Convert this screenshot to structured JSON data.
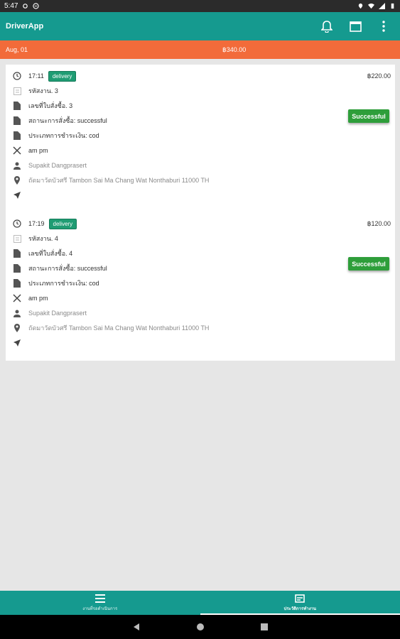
{
  "status_bar": {
    "time": "5:47"
  },
  "app": {
    "title": "DriverApp"
  },
  "summary": {
    "date": "Aug, 01",
    "total": "฿340.00"
  },
  "orders": [
    {
      "time": "17:11",
      "type_badge": "delivery",
      "price": "฿220.00",
      "status_button": "Successful",
      "employee": "รหัสงาน. 3",
      "order_no": "เลขที่ใบสั่งซื้อ. 3",
      "order_status": "สถานะการสั่งซื้อ: successful",
      "payment": "ประเภทการชำระเงิน: cod",
      "restaurant": "am pm",
      "customer": "Supakit Dangprasert",
      "address": "ถัดมาวัดบัวศรี Tambon Sai Ma Chang Wat Nonthaburi 11000 TH"
    },
    {
      "time": "17:19",
      "type_badge": "delivery",
      "price": "฿120.00",
      "status_button": "Successful",
      "employee": "รหัสงาน. 4",
      "order_no": "เลขที่ใบสั่งซื้อ. 4",
      "order_status": "สถานะการสั่งซื้อ: successful",
      "payment": "ประเภทการชำระเงิน: cod",
      "restaurant": "am pm",
      "customer": "Supakit Dangprasert",
      "address": "ถัดมาวัดบัวศรี Tambon Sai Ma Chang Wat Nonthaburi 11000 TH"
    }
  ],
  "bottom_nav": {
    "tabs": [
      {
        "label": "งานที่รอดำเนินการ",
        "icon": "list-icon"
      },
      {
        "label": "ประวัติการทำงาน",
        "icon": "history-icon"
      }
    ]
  },
  "colors": {
    "primary": "#159a8f",
    "summary": "#f26b3a",
    "success": "#2e9e3a",
    "badge": "#1f9c73"
  }
}
